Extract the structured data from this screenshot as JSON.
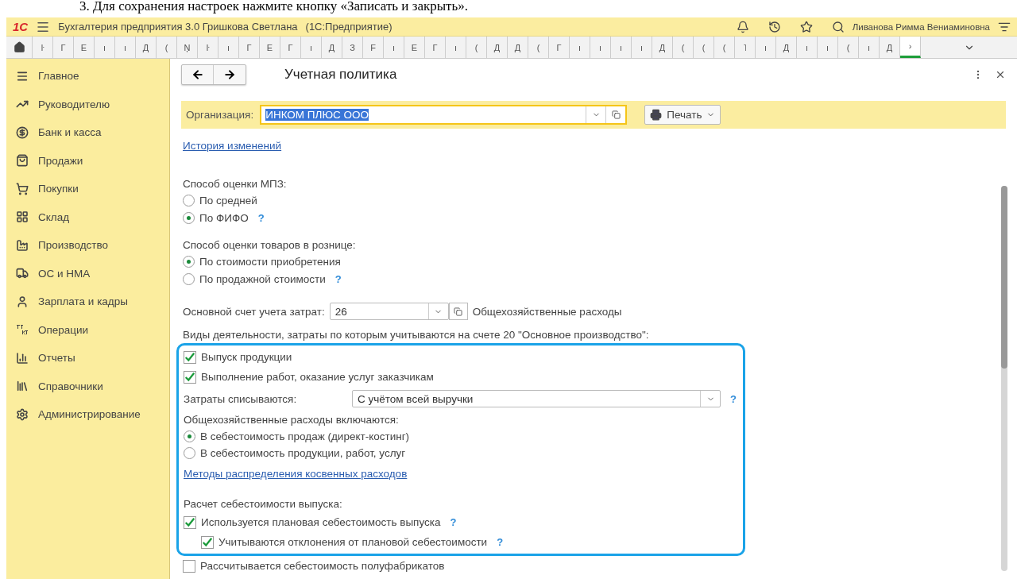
{
  "document_caption": "3. Для сохранения настроек нажмите кнопку «Записать и закрыть».",
  "app_bar": {
    "logo": "1С",
    "title": "Бухгалтерия предприятия 3.0 Гришкова Светлана",
    "platform": "(1С:Предприятие)",
    "user": "Ливанова Римма Вениаминовна"
  },
  "open_tabs": [
    {
      "label": "ŀ",
      "selected": false
    },
    {
      "label": "Г",
      "selected": false
    },
    {
      "label": "Е",
      "selected": false
    },
    {
      "label": "ı",
      "selected": false
    },
    {
      "label": "ı",
      "selected": false
    },
    {
      "label": "Д",
      "selected": false
    },
    {
      "label": "(",
      "selected": false
    },
    {
      "label": "Ņ",
      "selected": false
    },
    {
      "label": "ŀ",
      "selected": false
    },
    {
      "label": "ı",
      "selected": false
    },
    {
      "label": "Г",
      "selected": false
    },
    {
      "label": "Е",
      "selected": false
    },
    {
      "label": "Г",
      "selected": false
    },
    {
      "label": "ı",
      "selected": false
    },
    {
      "label": "Д",
      "selected": false
    },
    {
      "label": "З",
      "selected": false
    },
    {
      "label": "F",
      "selected": false
    },
    {
      "label": "ı",
      "selected": false
    },
    {
      "label": "Е",
      "selected": false
    },
    {
      "label": "Г",
      "selected": false
    },
    {
      "label": "ı",
      "selected": false
    },
    {
      "label": "(",
      "selected": false
    },
    {
      "label": "Д",
      "selected": false
    },
    {
      "label": "Д",
      "selected": false
    },
    {
      "label": "(",
      "selected": false
    },
    {
      "label": "Г",
      "selected": false
    },
    {
      "label": "ı",
      "selected": false
    },
    {
      "label": "ı",
      "selected": false
    },
    {
      "label": "ı",
      "selected": false
    },
    {
      "label": "ı",
      "selected": false
    },
    {
      "label": "Д",
      "selected": false
    },
    {
      "label": "(",
      "selected": false
    },
    {
      "label": "(",
      "selected": false
    },
    {
      "label": "(",
      "selected": false
    },
    {
      "label": "˥",
      "selected": false
    },
    {
      "label": "ı",
      "selected": false
    },
    {
      "label": "Д",
      "selected": false
    },
    {
      "label": "ı",
      "selected": false
    },
    {
      "label": "ı",
      "selected": false
    },
    {
      "label": "(",
      "selected": false
    },
    {
      "label": "ı",
      "selected": false
    },
    {
      "label": "Д",
      "selected": false
    },
    {
      "label": "›",
      "selected": true
    }
  ],
  "sidebar": {
    "items": [
      {
        "label": "Главное"
      },
      {
        "label": "Руководителю"
      },
      {
        "label": "Банк и касса"
      },
      {
        "label": "Продажи"
      },
      {
        "label": "Покупки"
      },
      {
        "label": "Склад"
      },
      {
        "label": "Производство"
      },
      {
        "label": "ОС и НМА"
      },
      {
        "label": "Зарплата и кадры"
      },
      {
        "label": "Операции"
      },
      {
        "label": "Отчеты"
      },
      {
        "label": "Справочники"
      },
      {
        "label": "Администрирование"
      }
    ]
  },
  "form": {
    "title": "Учетная политика",
    "organization": {
      "label": "Организация:",
      "value": "ИНКОМ ПЛЮС ООО"
    },
    "print_button": "Печать",
    "history_link": "История изменений",
    "rows": [
      {
        "kind": "label",
        "text": "Способ оценки МПЗ:"
      },
      {
        "kind": "radio",
        "text": "По средней",
        "selected": false
      },
      {
        "kind": "radio",
        "text": "По ФИФО",
        "selected": true,
        "help": "?"
      },
      {
        "kind": "gap"
      },
      {
        "kind": "label",
        "text": "Способ оценки товаров в рознице:"
      },
      {
        "kind": "radio",
        "text": "По стоимости приобретения",
        "selected": true
      },
      {
        "kind": "radio",
        "text": "По продажной стоимости",
        "selected": false,
        "help": "?"
      },
      {
        "kind": "gap"
      },
      {
        "kind": "account",
        "label": "Основной счет учета затрат:",
        "value": "26",
        "note": "Общехозяйственные расходы"
      },
      {
        "kind": "label",
        "text": "Виды деятельности, затраты по которым учитываются на счете 20 \"Основное производство\":"
      }
    ],
    "highlighted_rows": [
      {
        "kind": "checkbox",
        "text": "Выпуск продукции",
        "checked": true
      },
      {
        "kind": "checkbox",
        "text": "Выполнение работ, оказание услуг заказчикам",
        "checked": true
      },
      {
        "kind": "select",
        "label": "Затраты списываются:",
        "value": "С учётом всей выручки",
        "help": "?"
      },
      {
        "kind": "label",
        "text": "Общехозяйственные расходы включаются:"
      },
      {
        "kind": "radio",
        "text": "В себестоимость продаж (директ-костинг)",
        "selected": true
      },
      {
        "kind": "radio",
        "text": "В  себестоимость продукции, работ, услуг",
        "selected": false
      },
      {
        "kind": "link",
        "text": "Методы распределения косвенных расходов"
      },
      {
        "kind": "gap"
      },
      {
        "kind": "label",
        "text": "Расчет себестоимости выпуска:"
      },
      {
        "kind": "checkbox",
        "text": "Используется плановая себестоимость выпуска",
        "checked": true,
        "help": "?"
      },
      {
        "kind": "subcheckbox",
        "text": "Учитываются отклонения от плановой себестоимости",
        "checked": true,
        "help": "?"
      }
    ],
    "rows_after": [
      {
        "kind": "checkbox",
        "text": "Рассчитывается себестоимость полуфабрикатов",
        "checked": false
      }
    ]
  }
}
